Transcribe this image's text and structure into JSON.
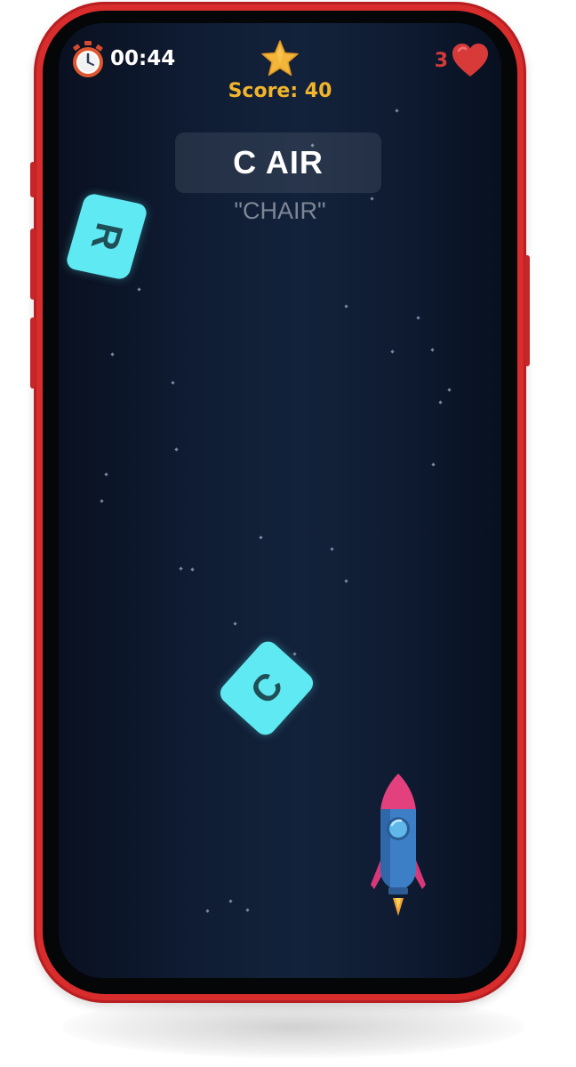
{
  "hud": {
    "timer": "00:44",
    "score_label": "Score: 40",
    "lives": "3"
  },
  "word": {
    "display": "C AIR",
    "hint": "\"CHAIR\""
  },
  "letters": [
    {
      "char": "R"
    },
    {
      "char": "C"
    }
  ],
  "colors": {
    "phone_frame": "#d92d2d",
    "screen_background": "#0f1c33",
    "score_yellow": "#f1b52b",
    "lives_red": "#d43a3a",
    "letter_tile": "#5fe9f2"
  },
  "icons": {
    "timer": "stopwatch-icon",
    "score": "star-icon",
    "lives": "heart-icon",
    "player": "rocket-icon"
  }
}
